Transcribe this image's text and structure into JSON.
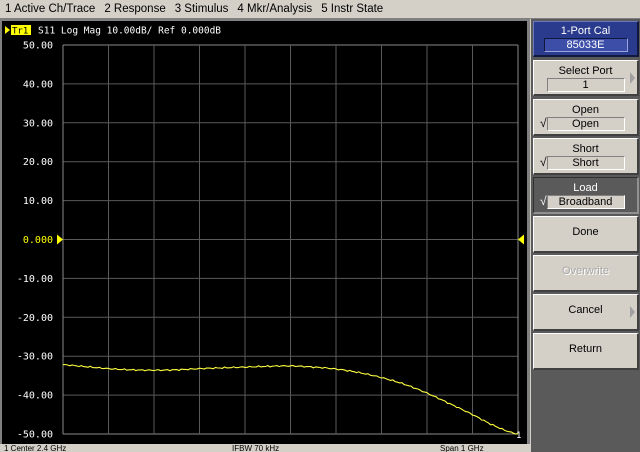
{
  "menu": [
    "1 Active Ch/Trace",
    "2 Response",
    "3 Stimulus",
    "4 Mkr/Analysis",
    "5 Instr State"
  ],
  "trace_header": {
    "badge": "Tr1",
    "text": "S11  Log Mag 10.00dB/ Ref 0.000dB"
  },
  "colors": {
    "trace": "#ffff40",
    "grid": "#5a5a5a",
    "background": "#000000",
    "axis_text": "#ffffff",
    "ref_marker": "#ffff00"
  },
  "chart_data": {
    "type": "line",
    "title": "S11  Log Mag 10.00dB/ Ref 0.000dB",
    "ylabel": "",
    "xlabel": "",
    "ylim": [
      -50,
      50
    ],
    "yticks": [
      "50.00",
      "40.00",
      "30.00",
      "20.00",
      "10.00",
      "0.000",
      "-10.00",
      "-20.00",
      "-30.00",
      "-40.00",
      "-50.00"
    ],
    "reference_level": "0.000",
    "x_divisions": 10,
    "x": [
      0,
      0.5,
      1,
      1.5,
      2,
      2.5,
      3,
      3.5,
      4,
      4.5,
      5,
      5.5,
      6,
      6.5,
      7,
      7.5,
      8,
      8.5,
      9,
      9.5,
      10
    ],
    "series": [
      {
        "values": [
          -32.2,
          -32.7,
          -33.2,
          -33.5,
          -33.6,
          -33.5,
          -33.2,
          -33.0,
          -32.8,
          -32.6,
          -32.5,
          -32.8,
          -33.3,
          -34.2,
          -35.5,
          -37.2,
          -39.5,
          -42.2,
          -45.0,
          -48.0,
          -50.0
        ]
      }
    ],
    "end_marker_label": "1"
  },
  "status_bar": {
    "left": "1  Center 2.4 GHz",
    "middle": "IFBW 70 kHz",
    "right": "Span 1 GHz"
  },
  "softkeys": {
    "title": "1-Port Cal",
    "title_value": "85033E",
    "select_port": {
      "label": "Select Port",
      "value": "1"
    },
    "open": {
      "check": "√",
      "label": "Open",
      "value": "Open"
    },
    "short": {
      "check": "√",
      "label": "Short",
      "value": "Short"
    },
    "load": {
      "check": "√",
      "label": "Load",
      "value": "Broadband"
    },
    "done": "Done",
    "overwrite": "Overwrite",
    "cancel": "Cancel",
    "return": "Return"
  }
}
